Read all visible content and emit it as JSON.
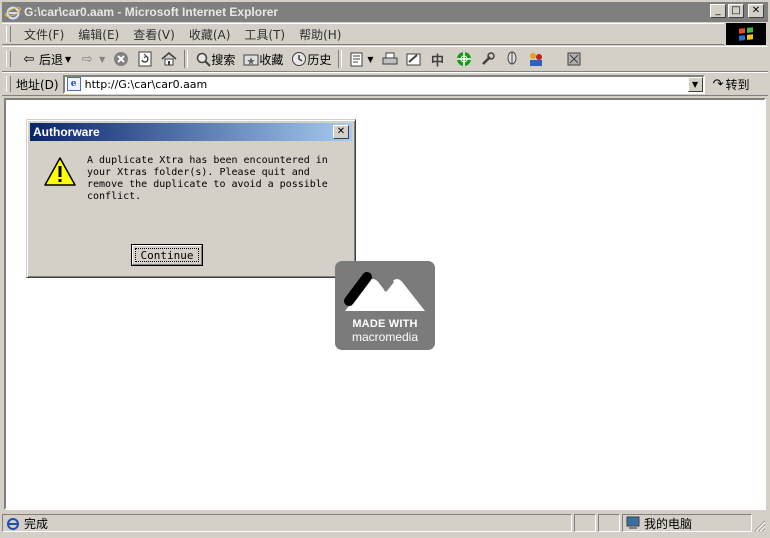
{
  "window": {
    "title": "G:\\car\\car0.aam - Microsoft Internet Explorer",
    "minimize": "_",
    "maximize": "□",
    "close": "✕"
  },
  "menu": {
    "items": [
      "文件(F)",
      "编辑(E)",
      "查看(V)",
      "收藏(A)",
      "工具(T)",
      "帮助(H)"
    ]
  },
  "toolbar": {
    "back": "后退",
    "search": "搜索",
    "favorites": "收藏",
    "history": "历史",
    "zh": "中"
  },
  "address": {
    "label": "地址(D)",
    "url": "http://G:\\car\\car0.aam",
    "go": "转到"
  },
  "dialog": {
    "title": "Authorware",
    "close": "✕",
    "message": "A duplicate Xtra has been encountered in\nyour Xtras folder(s). Please quit and\nremove the duplicate to avoid a possible\nconflict.",
    "button": "Continue"
  },
  "logo": {
    "line1": "MADE WITH",
    "line2": "macromedia"
  },
  "status": {
    "text": "完成",
    "zone": "我的电脑"
  },
  "colors": {
    "title_inactive": "#7f7f7f",
    "dialog_title_start": "#0a246a",
    "dialog_title_end": "#a6caf0",
    "logo_bg": "#7b7b7b"
  }
}
